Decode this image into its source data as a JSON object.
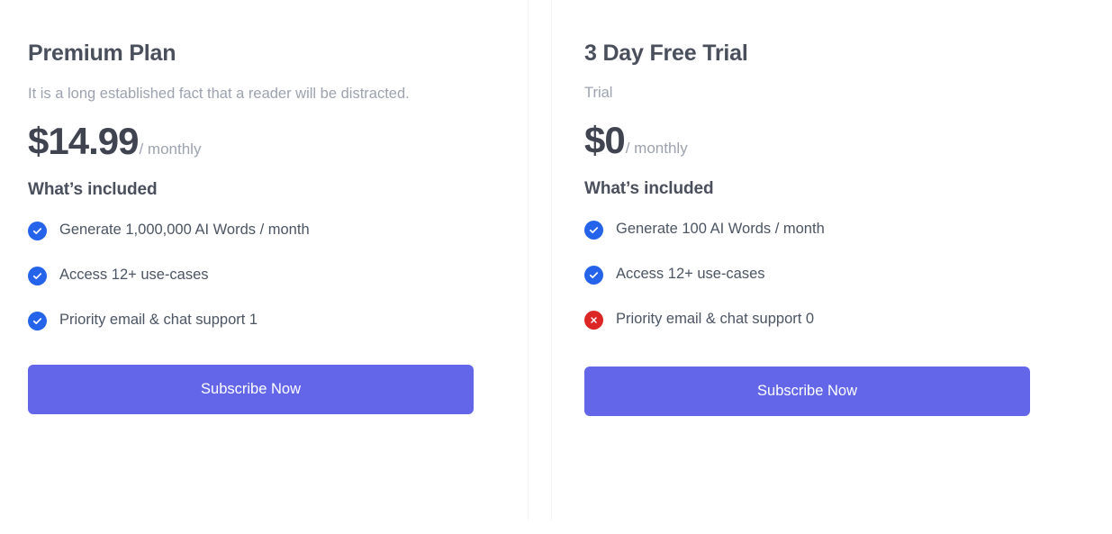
{
  "theme": {
    "button_color": "#6366e8",
    "check_color": "#2563eb",
    "cross_color": "#dc2626",
    "heading_color": "#4a4f5c",
    "muted_color": "#9ca3af",
    "body_color": "#4b5563",
    "background": "#ffffff",
    "divider_color": "#f4f5f7"
  },
  "plans": [
    {
      "id": "premium",
      "title": "Premium Plan",
      "description": "It is a long established fact that a reader will be distracted.",
      "price": "$14.99",
      "period": "/ monthly",
      "included_label": "What’s included",
      "features": [
        {
          "label": "Generate 1,000,000 AI Words / month",
          "icon": "check-circle-icon",
          "state": "included"
        },
        {
          "label": "Access 12+ use-cases",
          "icon": "check-circle-icon",
          "state": "included"
        },
        {
          "label": "Priority email & chat support 1",
          "icon": "check-circle-icon",
          "state": "included"
        }
      ],
      "cta_label": "Subscribe Now"
    },
    {
      "id": "free-trial",
      "title": "3 Day Free Trial",
      "description": "Trial",
      "price": "$0",
      "period": "/ monthly",
      "included_label": "What’s included",
      "features": [
        {
          "label": "Generate 100 AI Words / month",
          "icon": "check-circle-icon",
          "state": "included"
        },
        {
          "label": "Access 12+ use-cases",
          "icon": "check-circle-icon",
          "state": "included"
        },
        {
          "label": "Priority email & chat support 0",
          "icon": "x-circle-icon",
          "state": "excluded"
        }
      ],
      "cta_label": "Subscribe Now"
    }
  ]
}
